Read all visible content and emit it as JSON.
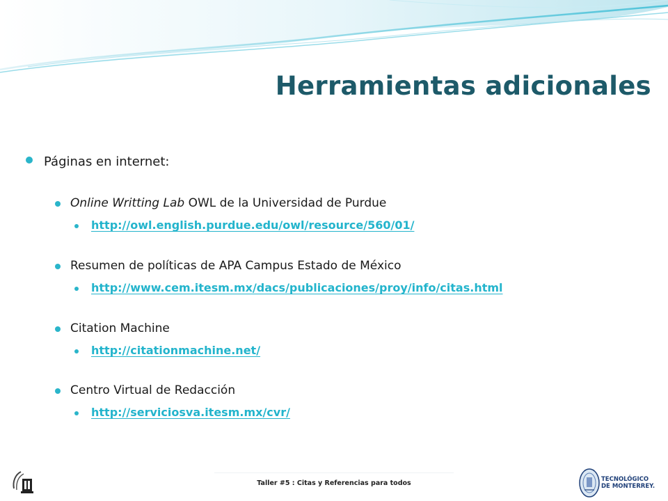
{
  "slide": {
    "title": "Herramientas adicionales",
    "bullet_intro": "Páginas en internet:",
    "items": [
      {
        "title_italic": "Online Writting Lab",
        "title_rest": " OWL de la Universidad de Purdue",
        "link": "http://owl.english.purdue.edu/owl/resource/560/01/"
      },
      {
        "title_italic": "",
        "title_rest": "Resumen de políticas de APA Campus Estado de México",
        "link": "http://www.cem.itesm.mx/dacs/publicaciones/proy/info/citas.html"
      },
      {
        "title_italic": "",
        "title_rest": "Citation Machine",
        "link": "http://citationmachine.net/"
      },
      {
        "title_italic": "",
        "title_rest": "Centro Virtual de Redacción",
        "link": "http://serviciosva.itesm.mx/cvr/"
      }
    ]
  },
  "footer": {
    "text": "Taller #5 :  Citas y Referencias para todos",
    "logo_right_line1": "TECNOLÓGICO",
    "logo_right_line2": "DE MONTERREY."
  },
  "colors": {
    "title": "#1d5a69",
    "bullet": "#2ab5ca",
    "link": "#23b4cc",
    "wave": "#4fc3d9"
  },
  "icons": {
    "left_logo": "library-logo-icon",
    "right_logo": "tec-monterrey-seal-icon"
  }
}
